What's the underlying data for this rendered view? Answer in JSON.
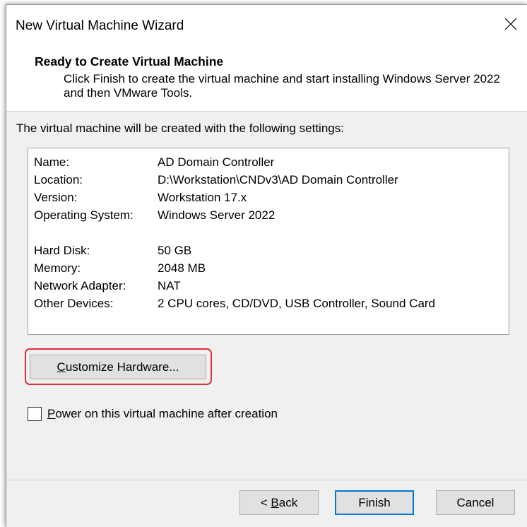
{
  "window": {
    "title": "New Virtual Machine Wizard"
  },
  "header": {
    "title": "Ready to Create Virtual Machine",
    "description": "Click Finish to create the virtual machine and start installing Windows Server 2022 and then VMware Tools."
  },
  "intro_text": "The virtual machine will be created with the following settings:",
  "settings": [
    {
      "label": "Name:",
      "value": "AD Domain Controller"
    },
    {
      "label": "Location:",
      "value": "D:\\Workstation\\CNDv3\\AD Domain Controller"
    },
    {
      "label": "Version:",
      "value": "Workstation 17.x"
    },
    {
      "label": "Operating System:",
      "value": "Windows Server 2022"
    },
    {
      "label": "Hard Disk:",
      "value": "50 GB"
    },
    {
      "label": "Memory:",
      "value": "2048 MB"
    },
    {
      "label": "Network Adapter:",
      "value": "NAT"
    },
    {
      "label": "Other Devices:",
      "value": "2 CPU cores, CD/DVD, USB Controller, Sound Card"
    }
  ],
  "customize_button": {
    "mnemonic": "C",
    "rest": "ustomize Hardware..."
  },
  "power_on": {
    "mnemonic": "P",
    "rest": "ower on this virtual machine after creation",
    "checked": false
  },
  "footer": {
    "back_prefix": "< ",
    "back_mnemonic": "B",
    "back_rest": "ack",
    "finish_label": "Finish",
    "cancel_label": "Cancel"
  },
  "colors": {
    "highlight_border": "#e0303a",
    "default_button_border": "#0078d7"
  },
  "icons": {
    "close": "close-icon"
  }
}
